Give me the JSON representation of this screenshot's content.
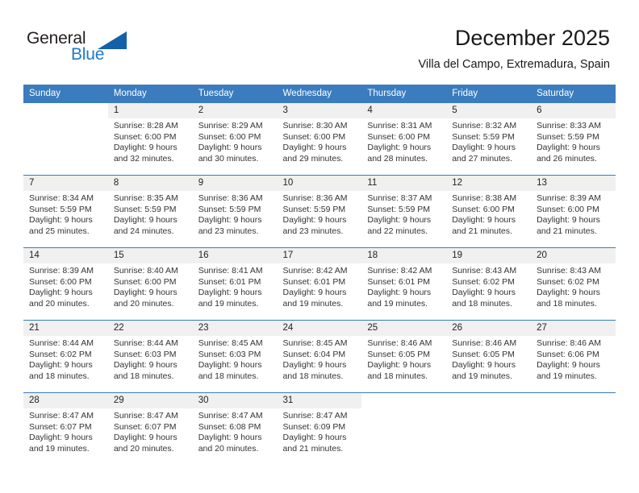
{
  "brand": {
    "name_part1": "General",
    "name_part2": "Blue",
    "accent_color": "#1361a8",
    "blue_text_color": "#2079c7"
  },
  "header": {
    "title": "December 2025",
    "subtitle": "Villa del Campo, Extremadura, Spain",
    "header_bg_color": "#3a7cbe"
  },
  "weekdays": [
    "Sunday",
    "Monday",
    "Tuesday",
    "Wednesday",
    "Thursday",
    "Friday",
    "Saturday"
  ],
  "weeks": [
    [
      {
        "day": "",
        "sunrise": "",
        "sunset": "",
        "daylight1": "",
        "daylight2": ""
      },
      {
        "day": "1",
        "sunrise": "Sunrise: 8:28 AM",
        "sunset": "Sunset: 6:00 PM",
        "daylight1": "Daylight: 9 hours",
        "daylight2": "and 32 minutes."
      },
      {
        "day": "2",
        "sunrise": "Sunrise: 8:29 AM",
        "sunset": "Sunset: 6:00 PM",
        "daylight1": "Daylight: 9 hours",
        "daylight2": "and 30 minutes."
      },
      {
        "day": "3",
        "sunrise": "Sunrise: 8:30 AM",
        "sunset": "Sunset: 6:00 PM",
        "daylight1": "Daylight: 9 hours",
        "daylight2": "and 29 minutes."
      },
      {
        "day": "4",
        "sunrise": "Sunrise: 8:31 AM",
        "sunset": "Sunset: 6:00 PM",
        "daylight1": "Daylight: 9 hours",
        "daylight2": "and 28 minutes."
      },
      {
        "day": "5",
        "sunrise": "Sunrise: 8:32 AM",
        "sunset": "Sunset: 5:59 PM",
        "daylight1": "Daylight: 9 hours",
        "daylight2": "and 27 minutes."
      },
      {
        "day": "6",
        "sunrise": "Sunrise: 8:33 AM",
        "sunset": "Sunset: 5:59 PM",
        "daylight1": "Daylight: 9 hours",
        "daylight2": "and 26 minutes."
      }
    ],
    [
      {
        "day": "7",
        "sunrise": "Sunrise: 8:34 AM",
        "sunset": "Sunset: 5:59 PM",
        "daylight1": "Daylight: 9 hours",
        "daylight2": "and 25 minutes."
      },
      {
        "day": "8",
        "sunrise": "Sunrise: 8:35 AM",
        "sunset": "Sunset: 5:59 PM",
        "daylight1": "Daylight: 9 hours",
        "daylight2": "and 24 minutes."
      },
      {
        "day": "9",
        "sunrise": "Sunrise: 8:36 AM",
        "sunset": "Sunset: 5:59 PM",
        "daylight1": "Daylight: 9 hours",
        "daylight2": "and 23 minutes."
      },
      {
        "day": "10",
        "sunrise": "Sunrise: 8:36 AM",
        "sunset": "Sunset: 5:59 PM",
        "daylight1": "Daylight: 9 hours",
        "daylight2": "and 23 minutes."
      },
      {
        "day": "11",
        "sunrise": "Sunrise: 8:37 AM",
        "sunset": "Sunset: 5:59 PM",
        "daylight1": "Daylight: 9 hours",
        "daylight2": "and 22 minutes."
      },
      {
        "day": "12",
        "sunrise": "Sunrise: 8:38 AM",
        "sunset": "Sunset: 6:00 PM",
        "daylight1": "Daylight: 9 hours",
        "daylight2": "and 21 minutes."
      },
      {
        "day": "13",
        "sunrise": "Sunrise: 8:39 AM",
        "sunset": "Sunset: 6:00 PM",
        "daylight1": "Daylight: 9 hours",
        "daylight2": "and 21 minutes."
      }
    ],
    [
      {
        "day": "14",
        "sunrise": "Sunrise: 8:39 AM",
        "sunset": "Sunset: 6:00 PM",
        "daylight1": "Daylight: 9 hours",
        "daylight2": "and 20 minutes."
      },
      {
        "day": "15",
        "sunrise": "Sunrise: 8:40 AM",
        "sunset": "Sunset: 6:00 PM",
        "daylight1": "Daylight: 9 hours",
        "daylight2": "and 20 minutes."
      },
      {
        "day": "16",
        "sunrise": "Sunrise: 8:41 AM",
        "sunset": "Sunset: 6:01 PM",
        "daylight1": "Daylight: 9 hours",
        "daylight2": "and 19 minutes."
      },
      {
        "day": "17",
        "sunrise": "Sunrise: 8:42 AM",
        "sunset": "Sunset: 6:01 PM",
        "daylight1": "Daylight: 9 hours",
        "daylight2": "and 19 minutes."
      },
      {
        "day": "18",
        "sunrise": "Sunrise: 8:42 AM",
        "sunset": "Sunset: 6:01 PM",
        "daylight1": "Daylight: 9 hours",
        "daylight2": "and 19 minutes."
      },
      {
        "day": "19",
        "sunrise": "Sunrise: 8:43 AM",
        "sunset": "Sunset: 6:02 PM",
        "daylight1": "Daylight: 9 hours",
        "daylight2": "and 18 minutes."
      },
      {
        "day": "20",
        "sunrise": "Sunrise: 8:43 AM",
        "sunset": "Sunset: 6:02 PM",
        "daylight1": "Daylight: 9 hours",
        "daylight2": "and 18 minutes."
      }
    ],
    [
      {
        "day": "21",
        "sunrise": "Sunrise: 8:44 AM",
        "sunset": "Sunset: 6:02 PM",
        "daylight1": "Daylight: 9 hours",
        "daylight2": "and 18 minutes."
      },
      {
        "day": "22",
        "sunrise": "Sunrise: 8:44 AM",
        "sunset": "Sunset: 6:03 PM",
        "daylight1": "Daylight: 9 hours",
        "daylight2": "and 18 minutes."
      },
      {
        "day": "23",
        "sunrise": "Sunrise: 8:45 AM",
        "sunset": "Sunset: 6:03 PM",
        "daylight1": "Daylight: 9 hours",
        "daylight2": "and 18 minutes."
      },
      {
        "day": "24",
        "sunrise": "Sunrise: 8:45 AM",
        "sunset": "Sunset: 6:04 PM",
        "daylight1": "Daylight: 9 hours",
        "daylight2": "and 18 minutes."
      },
      {
        "day": "25",
        "sunrise": "Sunrise: 8:46 AM",
        "sunset": "Sunset: 6:05 PM",
        "daylight1": "Daylight: 9 hours",
        "daylight2": "and 18 minutes."
      },
      {
        "day": "26",
        "sunrise": "Sunrise: 8:46 AM",
        "sunset": "Sunset: 6:05 PM",
        "daylight1": "Daylight: 9 hours",
        "daylight2": "and 19 minutes."
      },
      {
        "day": "27",
        "sunrise": "Sunrise: 8:46 AM",
        "sunset": "Sunset: 6:06 PM",
        "daylight1": "Daylight: 9 hours",
        "daylight2": "and 19 minutes."
      }
    ],
    [
      {
        "day": "28",
        "sunrise": "Sunrise: 8:47 AM",
        "sunset": "Sunset: 6:07 PM",
        "daylight1": "Daylight: 9 hours",
        "daylight2": "and 19 minutes."
      },
      {
        "day": "29",
        "sunrise": "Sunrise: 8:47 AM",
        "sunset": "Sunset: 6:07 PM",
        "daylight1": "Daylight: 9 hours",
        "daylight2": "and 20 minutes."
      },
      {
        "day": "30",
        "sunrise": "Sunrise: 8:47 AM",
        "sunset": "Sunset: 6:08 PM",
        "daylight1": "Daylight: 9 hours",
        "daylight2": "and 20 minutes."
      },
      {
        "day": "31",
        "sunrise": "Sunrise: 8:47 AM",
        "sunset": "Sunset: 6:09 PM",
        "daylight1": "Daylight: 9 hours",
        "daylight2": "and 21 minutes."
      },
      {
        "day": "",
        "sunrise": "",
        "sunset": "",
        "daylight1": "",
        "daylight2": ""
      },
      {
        "day": "",
        "sunrise": "",
        "sunset": "",
        "daylight1": "",
        "daylight2": ""
      },
      {
        "day": "",
        "sunrise": "",
        "sunset": "",
        "daylight1": "",
        "daylight2": ""
      }
    ]
  ]
}
